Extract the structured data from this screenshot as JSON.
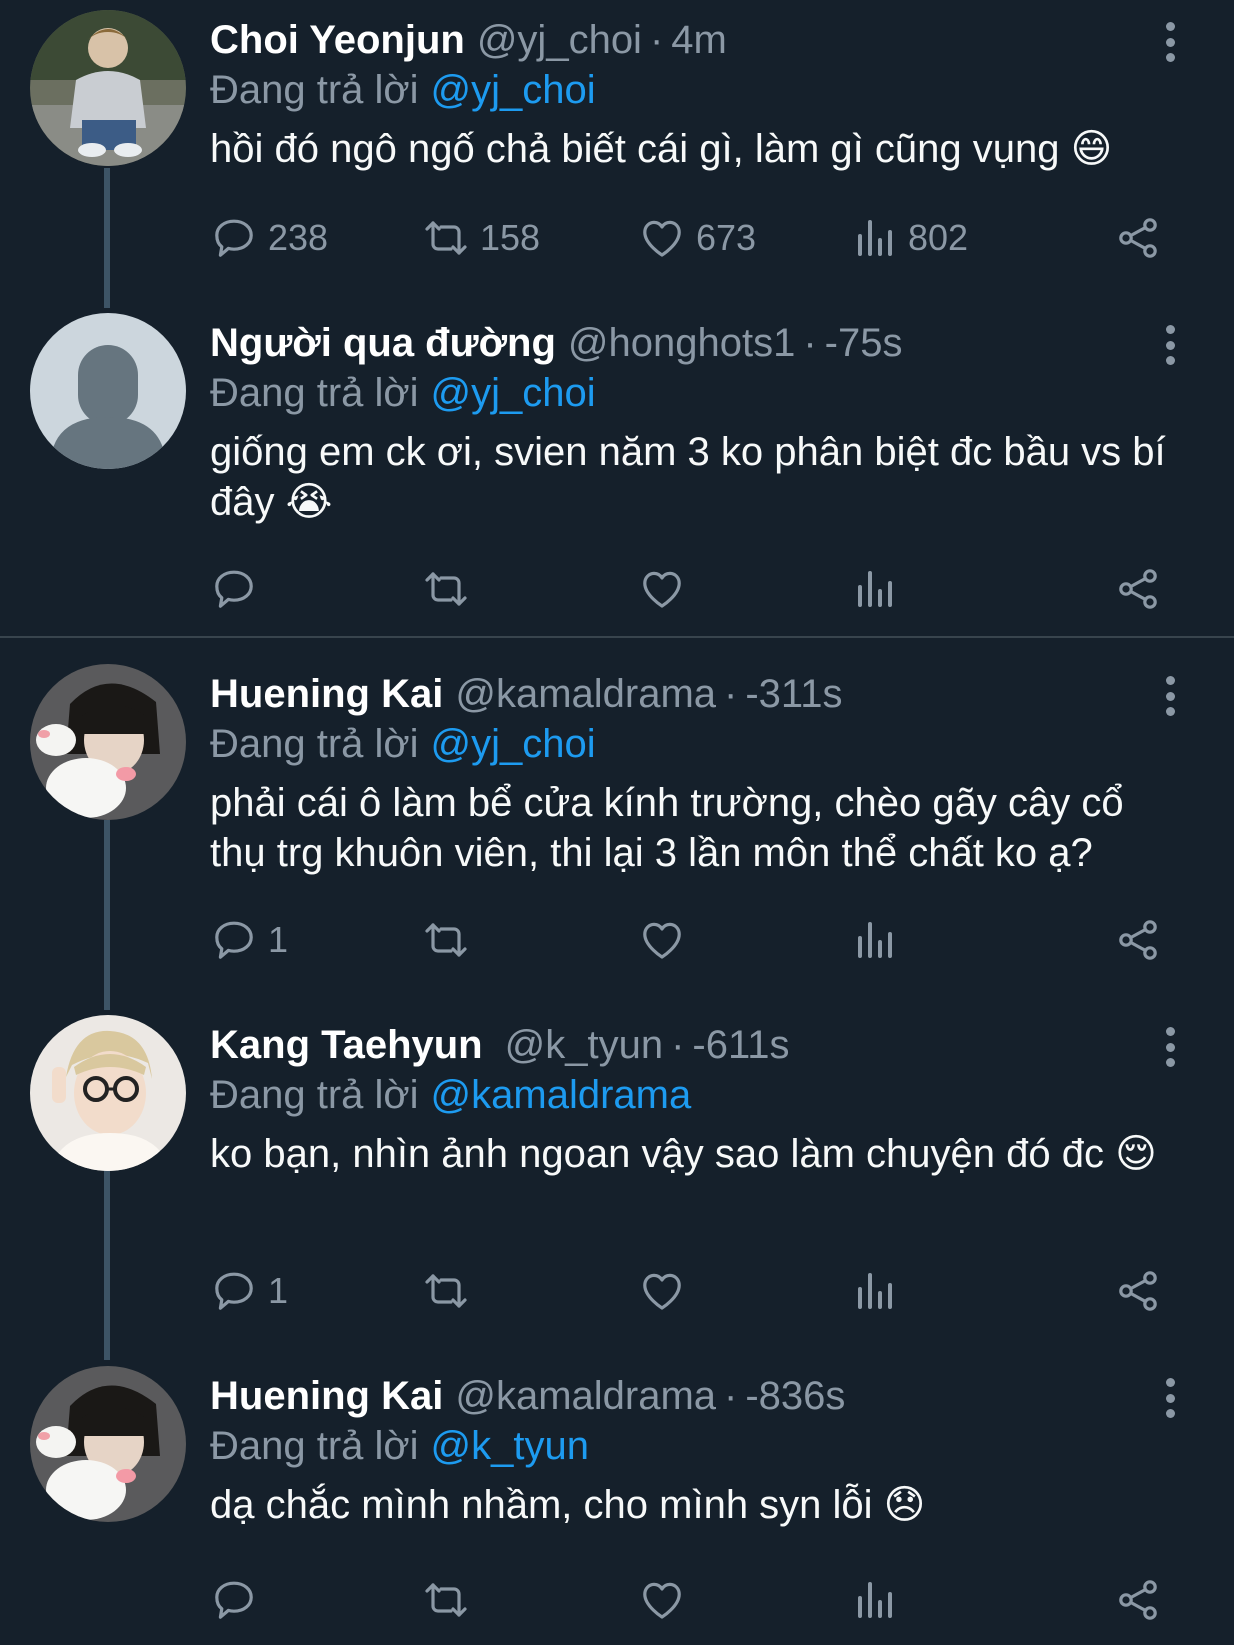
{
  "colors": {
    "background": "#15202b",
    "secondary_text": "#8b98a5",
    "mention": "#1d9bf0",
    "thread_line": "#3d5466"
  },
  "replying_prefix": "Đang trả lời",
  "tweets": [
    {
      "name": "Choi Yeonjun",
      "handle": "@yj_choi",
      "time": "4m",
      "reply_to": "@yj_choi",
      "text": "hồi đó ngô ngố chả biết cái gì, làm gì cũng vụng 😄",
      "replies": "238",
      "retweets": "158",
      "likes": "673",
      "views": "802"
    },
    {
      "name": "Người qua đường",
      "handle": "@honghots1",
      "time": "-75s",
      "reply_to": "@yj_choi",
      "text": "giống em ck ơi, svien năm 3 ko phân biệt đc bầu vs bí đây 😭",
      "replies": "",
      "retweets": "",
      "likes": "",
      "views": ""
    },
    {
      "name": "Huening Kai",
      "handle": "@kamaldrama",
      "time": "-311s",
      "reply_to": "@yj_choi",
      "text": "phải cái ô làm bể cửa kính trường, chèo gãy cây cổ thụ trg khuôn viên, thi lại 3 lần môn thể chất ko ạ?",
      "replies": "1",
      "retweets": "",
      "likes": "",
      "views": ""
    },
    {
      "name": "Kang Taehyun",
      "handle": "@k_tyun",
      "time": "-611s",
      "reply_to": "@kamaldrama",
      "text": "ko bạn, nhìn ảnh ngoan vậy sao làm chuyện đó đc 😌",
      "replies": "1",
      "retweets": "",
      "likes": "",
      "views": ""
    },
    {
      "name": "Huening Kai",
      "handle": "@kamaldrama",
      "time": "-836s",
      "reply_to": "@k_tyun",
      "text": "dạ chắc mình nhầm, cho mình syn lỗi 😞",
      "replies": "",
      "retweets": "",
      "likes": "",
      "views": ""
    }
  ]
}
